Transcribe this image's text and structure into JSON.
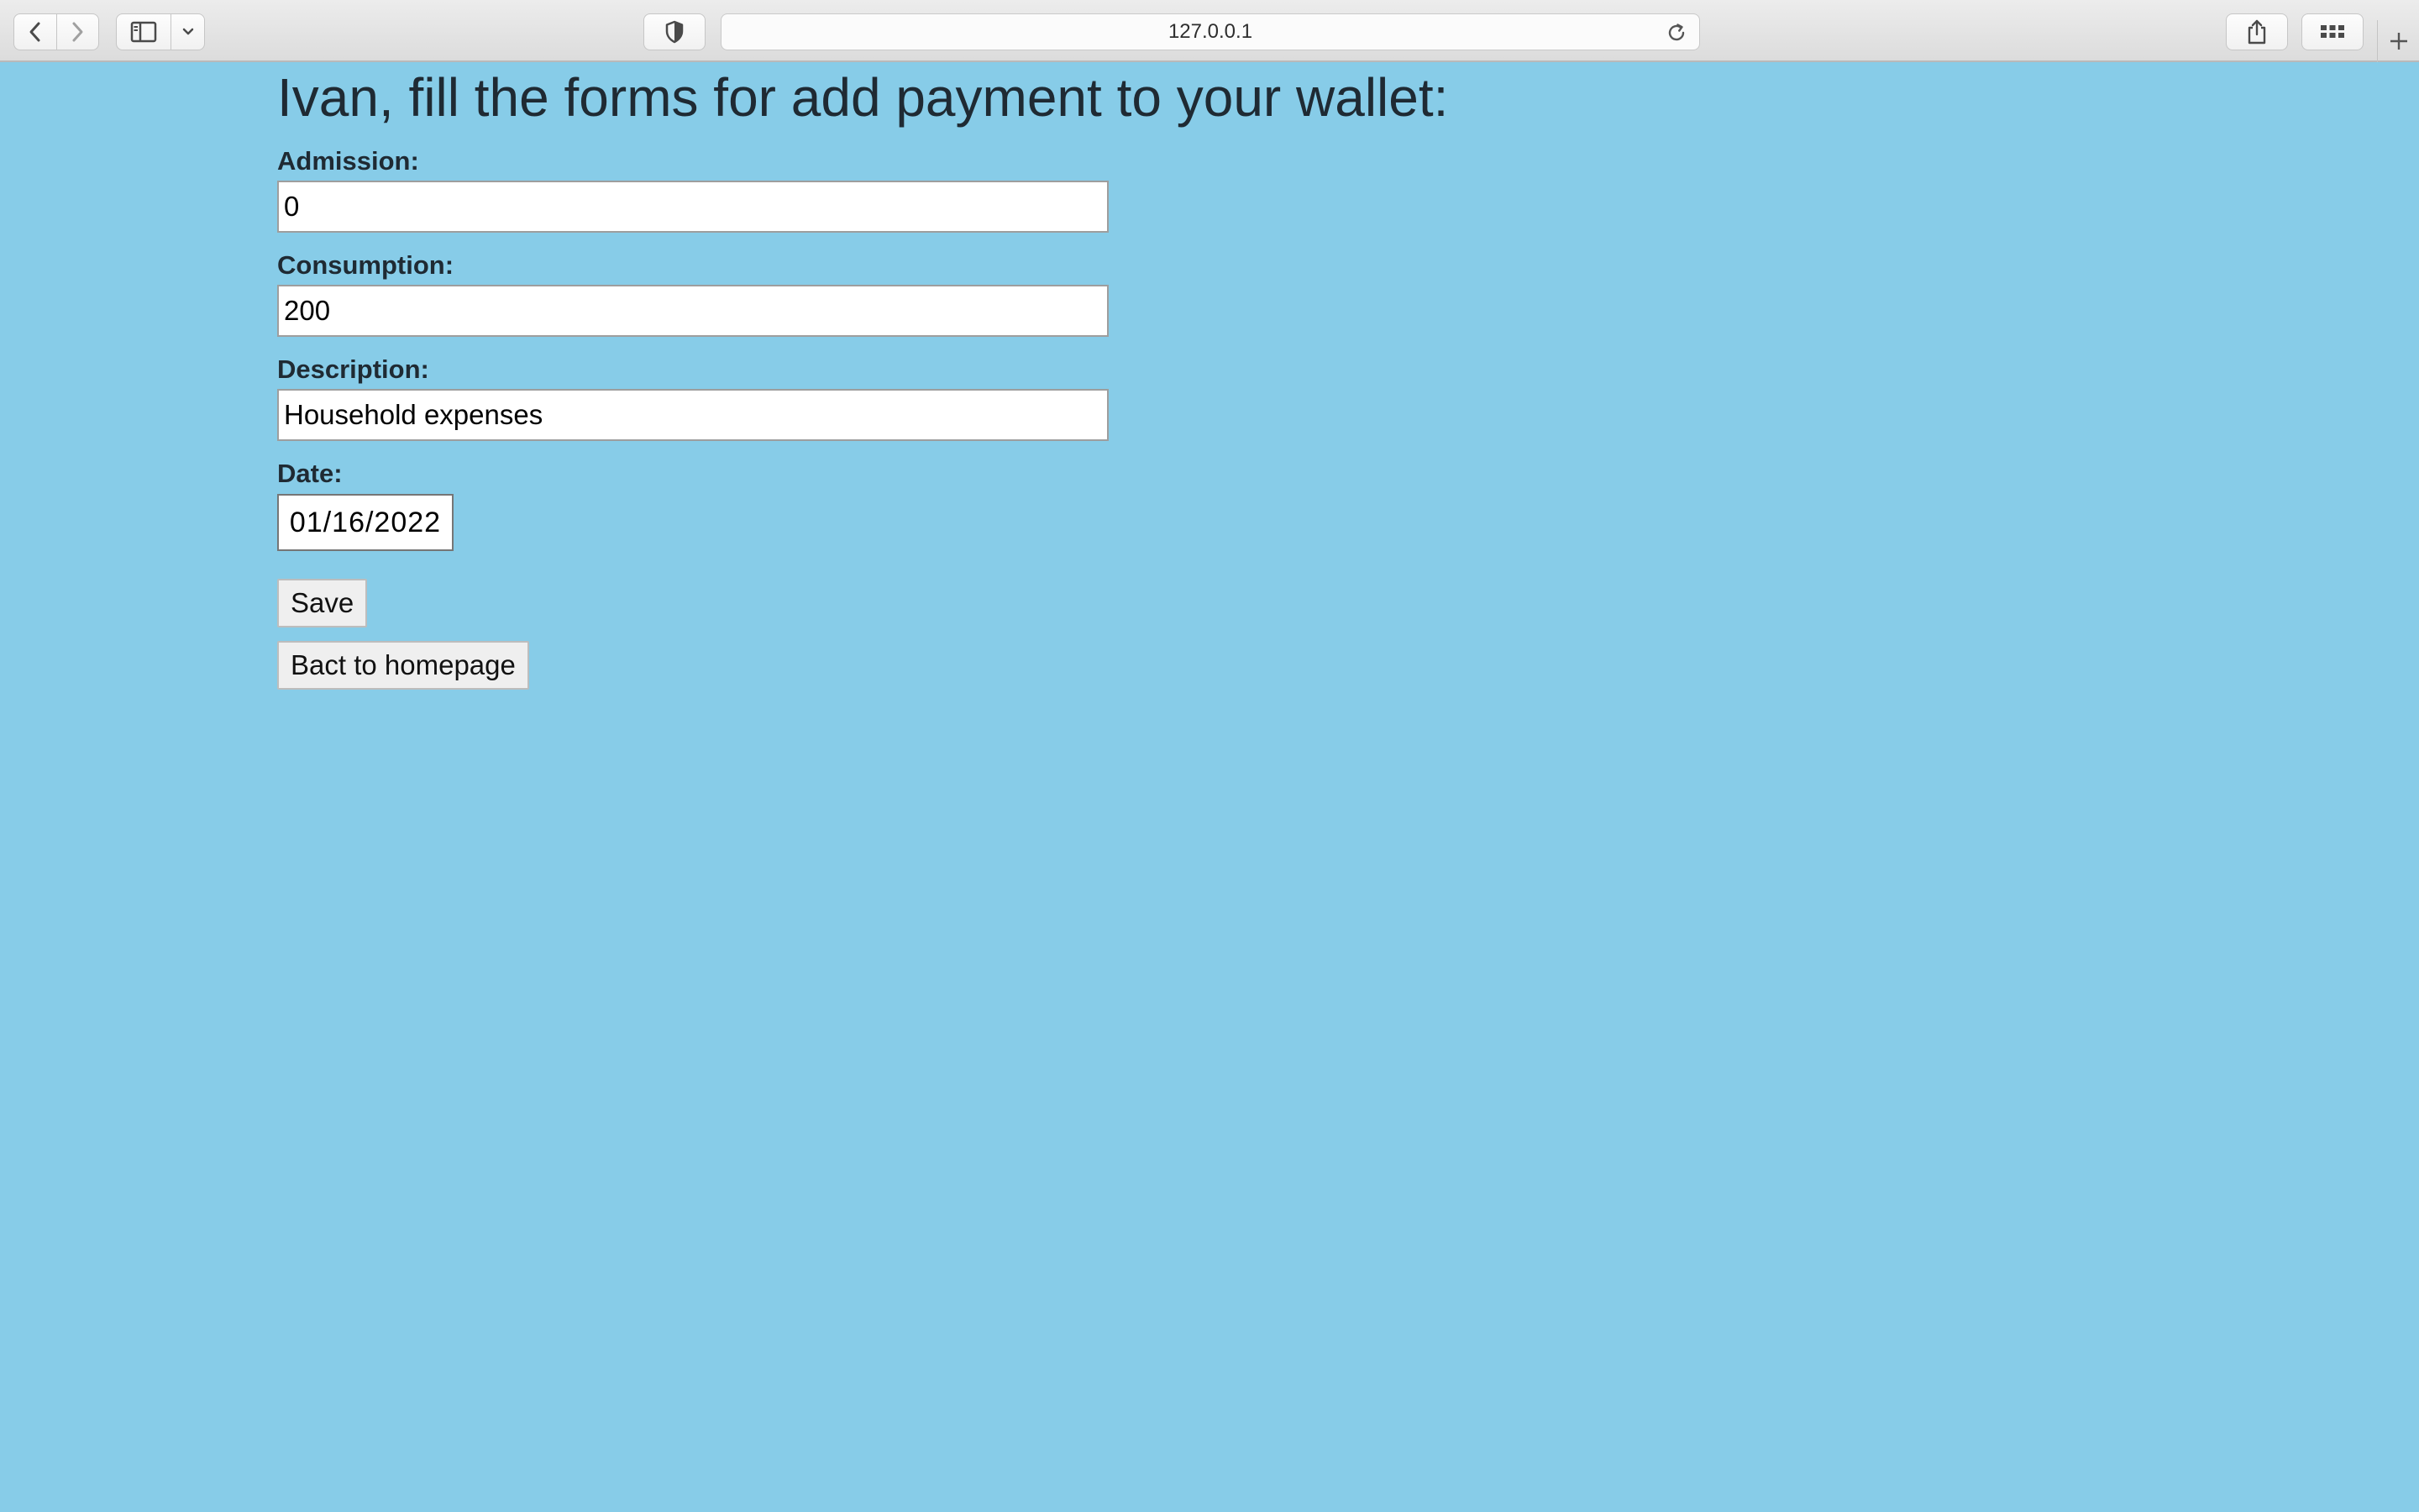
{
  "browser": {
    "url": "127.0.0.1"
  },
  "page": {
    "title": "Ivan, fill the forms for add payment to your wallet:"
  },
  "form": {
    "admission": {
      "label": "Admission:",
      "value": "0"
    },
    "consumption": {
      "label": "Consumption:",
      "value": "200"
    },
    "description": {
      "label": "Description:",
      "value": "Household expenses"
    },
    "date": {
      "label": "Date:",
      "value": "01/16/2022"
    },
    "save_label": "Save",
    "back_label": "Bact to homepage"
  },
  "colors": {
    "page_background": "#87cce8",
    "text": "#1f2a33"
  },
  "icons": {
    "back": "chevron-left-icon",
    "forward": "chevron-right-icon",
    "sidebar": "sidebar-icon",
    "sidebar_menu": "chevron-down-icon",
    "privacy": "shield-icon",
    "reload": "reload-icon",
    "share": "share-icon",
    "tabs": "tab-overview-icon",
    "new_tab": "plus-icon"
  }
}
